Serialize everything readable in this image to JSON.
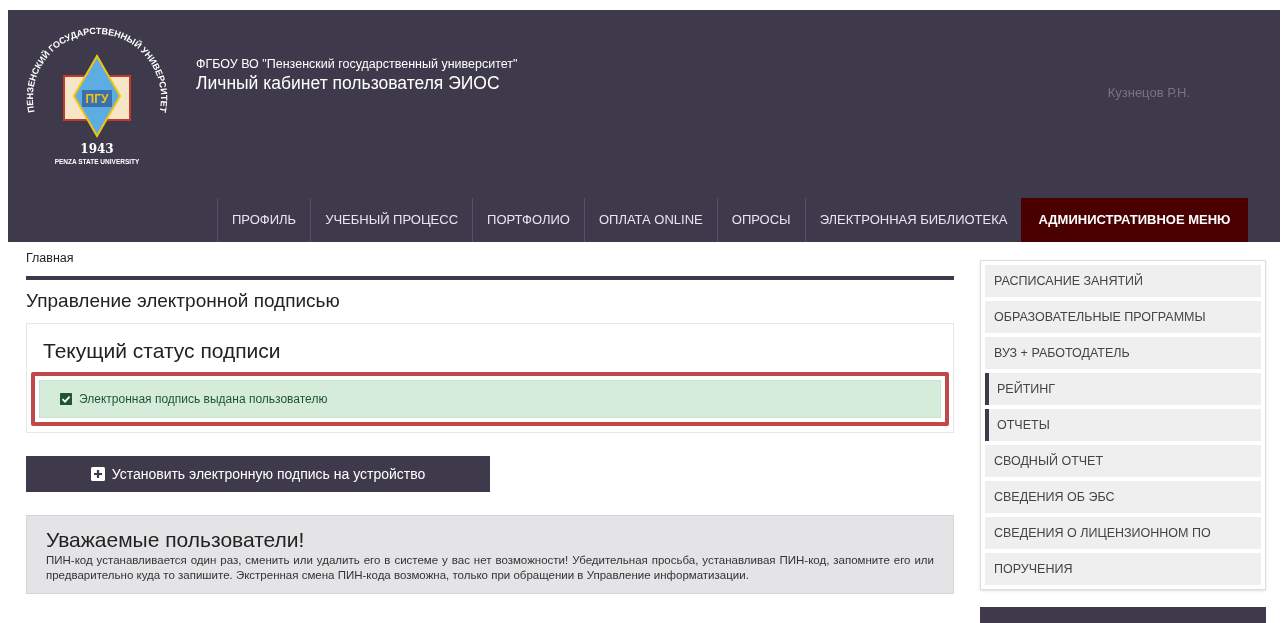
{
  "logo": {
    "arc_text": "ПЕНЗЕНСКИЙ ГОСУДАРСТВЕННЫЙ УНИВЕРСИТЕТ",
    "emblem_text": "ПГУ",
    "year": "1943",
    "caption": "PENZA STATE UNIVERSITY"
  },
  "header": {
    "org": "ФГБОУ ВО \"Пензенский государственный университет\"",
    "title": "Личный кабинет пользователя ЭИОС",
    "user": "Кузнецов Р.Н."
  },
  "nav": [
    {
      "label": "ПРОФИЛЬ",
      "selected": false
    },
    {
      "label": "УЧЕБНЫЙ ПРОЦЕСС",
      "selected": false
    },
    {
      "label": "ПОРТФОЛИО",
      "selected": false
    },
    {
      "label": "ОПЛАТА ONLINE",
      "selected": false
    },
    {
      "label": "ОПРОСЫ",
      "selected": false
    },
    {
      "label": "ЭЛЕКТРОННАЯ БИБЛИОТЕКА",
      "selected": false
    },
    {
      "label": "АДМИНИСТРАТИВНОЕ МЕНЮ",
      "selected": true
    }
  ],
  "breadcrumb": "Главная",
  "page_title": "Управление электронной подписью",
  "status_card": {
    "title": "Текущий статус подписи",
    "message": "Электронная подпись выдана пользователю",
    "checked": true,
    "highlighted": true
  },
  "install_button": "Установить электронную подпись на устройство",
  "notice": {
    "title": "Уважаемые пользователи!",
    "text": "ПИН-код устанавливается один раз, сменить или удалить его в системе у вас нет возможности! Убедительная просьба, устанавливая ПИН-код, запомните его или предварительно куда то запишите. Экстренная смена ПИН-кода возможна, только при обращении в Управление информатизации."
  },
  "sidebar": [
    {
      "label": "РАСПИСАНИЕ ЗАНЯТИЙ",
      "marked": false
    },
    {
      "label": "ОБРАЗОВАТЕЛЬНЫЕ ПРОГРАММЫ",
      "marked": false
    },
    {
      "label": "ВУЗ + РАБОТОДАТЕЛЬ",
      "marked": false
    },
    {
      "label": "РЕЙТИНГ",
      "marked": true
    },
    {
      "label": "ОТЧЕТЫ",
      "marked": true
    },
    {
      "label": "СВОДНЫЙ ОТЧЕТ",
      "marked": false
    },
    {
      "label": "СВЕДЕНИЯ ОБ ЭБС",
      "marked": false
    },
    {
      "label": "СВЕДЕНИЯ О ЛИЦЕНЗИОННОМ ПО",
      "marked": false
    },
    {
      "label": "ПОРУЧЕНИЯ",
      "marked": false
    }
  ]
}
